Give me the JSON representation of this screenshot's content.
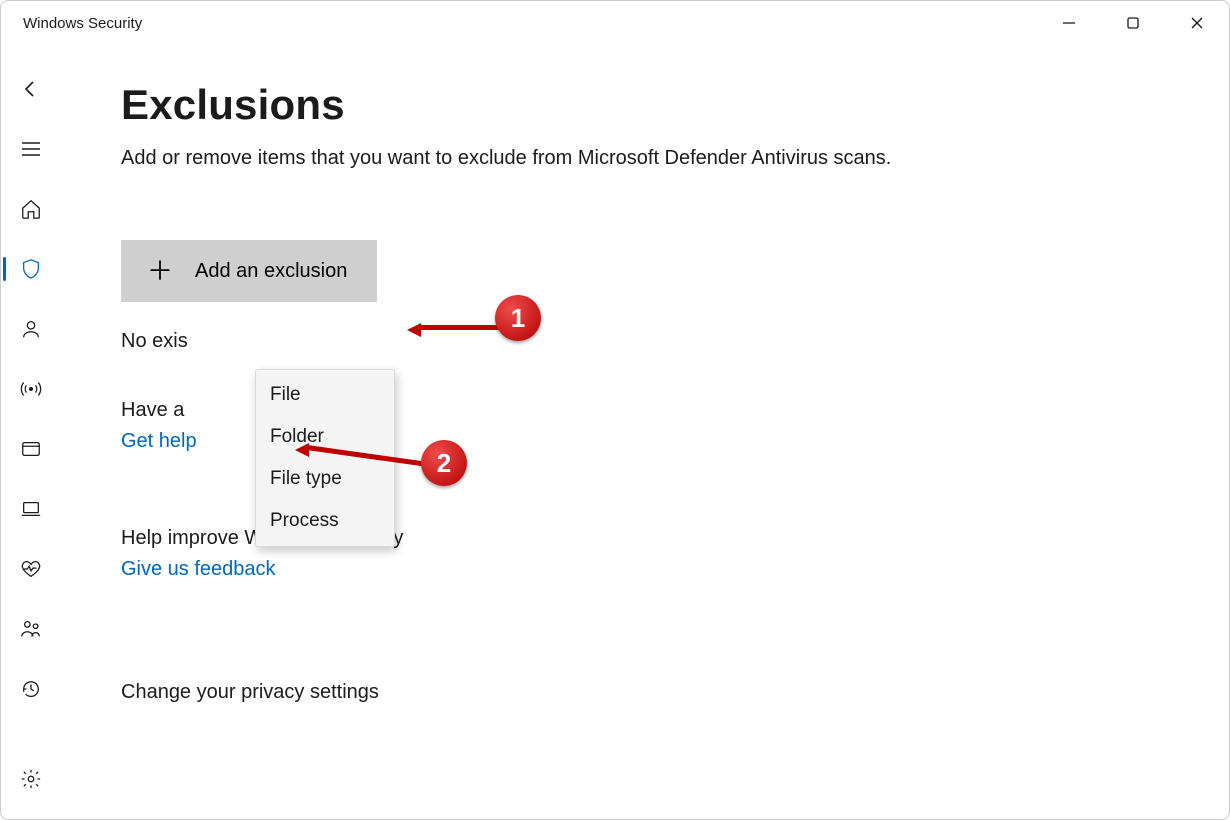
{
  "titlebar": {
    "app_title": "Windows Security"
  },
  "page": {
    "heading": "Exclusions",
    "subtitle": "Add or remove items that you want to exclude from Microsoft Defender Antivirus scans.",
    "add_button_label": "Add an exclusion",
    "status_line": "No exis",
    "question_head": "Have a",
    "get_help_link": "Get help",
    "improve_head": "Help improve Windows Security",
    "feedback_link": "Give us feedback",
    "privacy_head": "Change your privacy settings"
  },
  "dropdown": {
    "items": [
      "File",
      "Folder",
      "File type",
      "Process"
    ]
  },
  "annotations": {
    "badge1": "1",
    "badge2": "2"
  }
}
